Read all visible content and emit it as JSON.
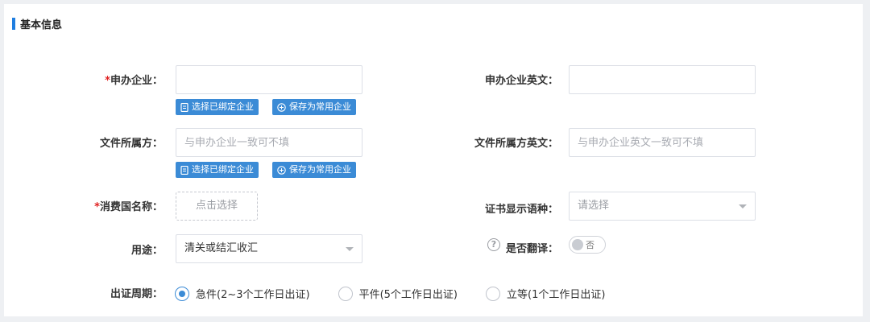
{
  "section": {
    "title": "基本信息"
  },
  "fields": {
    "applicant": {
      "label": "申办企业：",
      "required_mark": "*",
      "value": "",
      "placeholder": "",
      "btn_select": "选择已绑定企业",
      "btn_save": "保存为常用企业"
    },
    "applicant_en": {
      "label": "申办企业英文：",
      "value": "",
      "placeholder": ""
    },
    "owner": {
      "label": "文件所属方：",
      "value": "",
      "placeholder": "与申办企业一致可不填",
      "btn_select": "选择已绑定企业",
      "btn_save": "保存为常用企业"
    },
    "owner_en": {
      "label": "文件所属方英文：",
      "value": "",
      "placeholder": "与申办企业英文一致可不填"
    },
    "consumer_country": {
      "label": "消费国名称：",
      "required_mark": "*",
      "button": "点击选择"
    },
    "cert_language": {
      "label": "证书显示语种：",
      "placeholder": "请选择"
    },
    "purpose": {
      "label": "用途：",
      "value": "清关或结汇收汇"
    },
    "translate": {
      "label": "是否翻译：",
      "help": "?",
      "toggle_label": "否",
      "on": false
    },
    "period": {
      "label": "出证周期：",
      "options": [
        {
          "label": "急件(2~3个工作日出证)",
          "checked": true
        },
        {
          "label": "平件(5个工作日出证)",
          "checked": false
        },
        {
          "label": "立等(1个工作日出证)",
          "checked": false
        }
      ]
    }
  },
  "colors": {
    "accent": "#3b8bd6",
    "required": "#e02020",
    "section_bar": "#1f7ee0"
  },
  "icons": {
    "select_btn": "document-icon",
    "save_btn": "plus-circle-icon"
  }
}
